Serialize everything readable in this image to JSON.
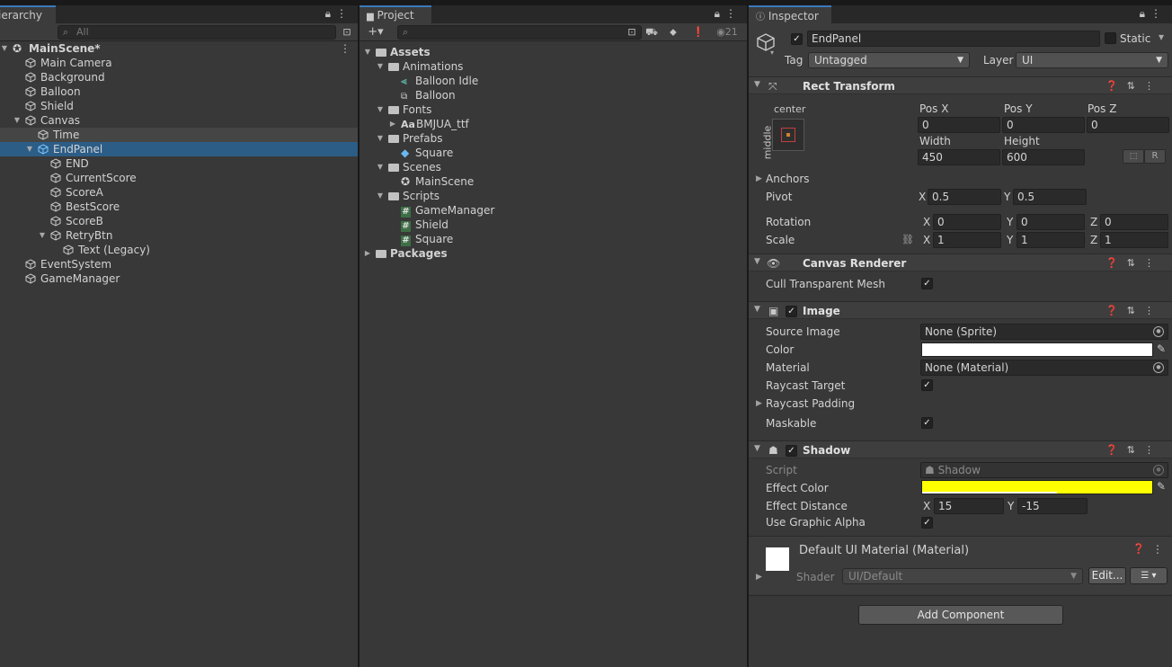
{
  "hierarchy": {
    "tab": "ierarchy",
    "search_placeholder": "All",
    "scene": "MainScene*",
    "items": [
      {
        "label": "Main Camera"
      },
      {
        "label": "Background"
      },
      {
        "label": "Balloon"
      },
      {
        "label": "Shield"
      },
      {
        "label": "Canvas"
      },
      {
        "label": "Time"
      },
      {
        "label": "EndPanel"
      },
      {
        "label": "END"
      },
      {
        "label": "CurrentScore"
      },
      {
        "label": "ScoreA"
      },
      {
        "label": "BestScore"
      },
      {
        "label": "ScoreB"
      },
      {
        "label": "RetryBtn"
      },
      {
        "label": "Text (Legacy)"
      },
      {
        "label": "EventSystem"
      },
      {
        "label": "GameManager"
      }
    ]
  },
  "project": {
    "tab": "Project",
    "hidden_count": "21",
    "items": [
      {
        "label": "Assets"
      },
      {
        "label": "Animations"
      },
      {
        "label": "Balloon Idle"
      },
      {
        "label": "Balloon"
      },
      {
        "label": "Fonts"
      },
      {
        "label": "BMJUA_ttf"
      },
      {
        "label": "Prefabs"
      },
      {
        "label": "Square"
      },
      {
        "label": "Scenes"
      },
      {
        "label": "MainScene"
      },
      {
        "label": "Scripts"
      },
      {
        "label": "GameManager"
      },
      {
        "label": "Shield"
      },
      {
        "label": "Square"
      },
      {
        "label": "Packages"
      }
    ],
    "font_icon": "Aa"
  },
  "inspector": {
    "tab": "Inspector",
    "object_name": "EndPanel",
    "static_label": "Static",
    "tag_label": "Tag",
    "tag_value": "Untagged",
    "layer_label": "Layer",
    "layer_value": "UI",
    "rect": {
      "title": "Rect Transform",
      "anchor_h": "center",
      "anchor_v": "middle",
      "posx_label": "Pos X",
      "posy_label": "Pos Y",
      "posz_label": "Pos Z",
      "posx": "0",
      "posy": "0",
      "posz": "0",
      "width_label": "Width",
      "height_label": "Height",
      "width": "450",
      "height": "600",
      "r_label": "R",
      "anchors_label": "Anchors",
      "pivot_label": "Pivot",
      "pivot_x": "0.5",
      "pivot_y": "0.5",
      "rotation_label": "Rotation",
      "rot_x": "0",
      "rot_y": "0",
      "rot_z": "0",
      "scale_label": "Scale",
      "scale_x": "1",
      "scale_y": "1",
      "scale_z": "1",
      "x": "X",
      "y": "Y",
      "z": "Z"
    },
    "canvas_renderer": {
      "title": "Canvas Renderer",
      "cull_label": "Cull Transparent Mesh"
    },
    "image": {
      "title": "Image",
      "source_label": "Source Image",
      "source_value": "None (Sprite)",
      "color_label": "Color",
      "color_value": "#ffffff",
      "material_label": "Material",
      "material_value": "None (Material)",
      "raycast_label": "Raycast Target",
      "padding_label": "Raycast Padding",
      "maskable_label": "Maskable"
    },
    "shadow": {
      "title": "Shadow",
      "script_label": "Script",
      "script_value": "Shadow",
      "effect_color_label": "Effect Color",
      "effect_color_value": "#ffff00",
      "distance_label": "Effect Distance",
      "dist_x": "15",
      "dist_y": "-15",
      "alpha_label": "Use Graphic Alpha"
    },
    "material": {
      "title": "Default UI Material (Material)",
      "shader_label": "Shader",
      "shader_value": "UI/Default",
      "edit_label": "Edit..."
    },
    "add_component": "Add Component"
  },
  "colors": {
    "selection": "#2c5d87",
    "accent_tab": "#3a79bb",
    "panel_bg": "#383838"
  }
}
